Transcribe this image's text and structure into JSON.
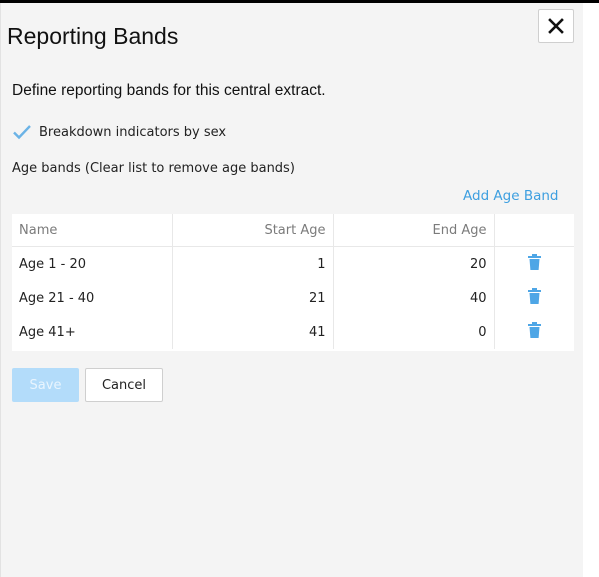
{
  "dialog": {
    "title": "Reporting Bands",
    "description": "Define reporting bands for this central extract.",
    "close_icon": "close-icon"
  },
  "sex_breakdown": {
    "label": "Breakdown indicators by sex",
    "checked": true
  },
  "age_bands": {
    "label": "Age bands (Clear list to remove age bands)",
    "add_label": "Add Age Band",
    "columns": [
      "Name",
      "Start Age",
      "End Age",
      ""
    ],
    "rows": [
      {
        "name": "Age 1 - 20",
        "start": "1",
        "end": "20"
      },
      {
        "name": "Age 21 - 40",
        "start": "21",
        "end": "40"
      },
      {
        "name": "Age 41+",
        "start": "41",
        "end": "0"
      }
    ]
  },
  "actions": {
    "save_label": "Save",
    "cancel_label": "Cancel",
    "save_disabled": true
  },
  "colors": {
    "accent": "#3d9fe0",
    "disabled_button": "#b3dcfa",
    "panel_bg": "#f4f4f4"
  }
}
